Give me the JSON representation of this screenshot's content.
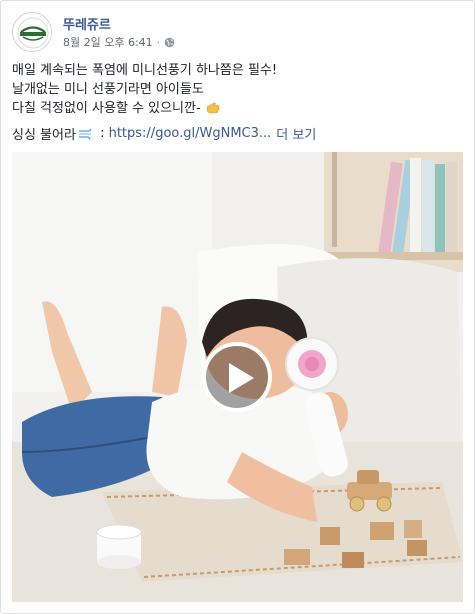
{
  "post": {
    "page_name": "뚜레쥬르",
    "timestamp": "8월 2일 오후 6:41",
    "separator": "·",
    "privacy_icon": "globe-icon",
    "text_lines": [
      "매일 계속되는 폭염에 미니선풍기 하나쯤은 필수!",
      "날개없는 미니 선풍기라면 아이들도",
      "다칠 걱정없이 사용할 수 있으니깐-"
    ],
    "hand_emoji": "pointing-hand-icon",
    "link_prefix": "싱싱 불어라",
    "wind_emoji": "wind-blowing-icon",
    "link_colon": " : ",
    "link_url": "https://goo.gl/WgNMC3...",
    "see_more": "더 보기"
  },
  "media": {
    "type": "video",
    "play_icon": "play-icon"
  },
  "colors": {
    "link": "#385898",
    "text": "#1d2129",
    "meta": "#616770",
    "brand_green": "#2e6b3a"
  }
}
